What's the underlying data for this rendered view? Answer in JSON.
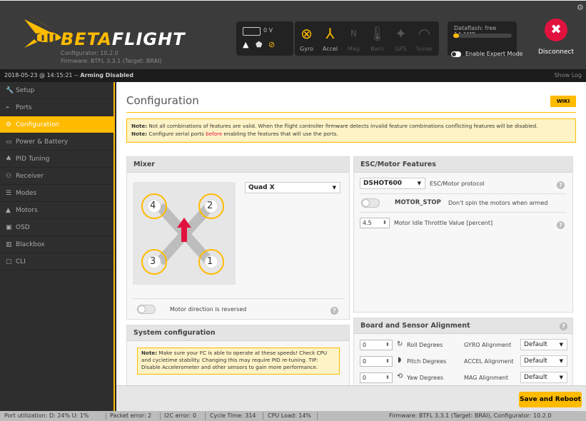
{
  "header": {
    "brand_left": "BETA",
    "brand_right": "FLIGHT",
    "configurator_version": "Configurator: 10.2.0",
    "firmware_version": "Firmware: BTFL 3.3.1 (Target: BRAI)",
    "battery_voltage": "0 V",
    "sensors": [
      {
        "label": "Gyro",
        "icon": "gyro-icon",
        "active": true
      },
      {
        "label": "Accel",
        "icon": "accel-icon",
        "active": true
      },
      {
        "label": "Mag",
        "icon": "mag-icon",
        "active": false
      },
      {
        "label": "Baro",
        "icon": "baro-icon",
        "active": false
      },
      {
        "label": "GPS",
        "icon": "gps-icon",
        "active": false
      },
      {
        "label": "Sonar",
        "icon": "sonar-icon",
        "active": false
      }
    ],
    "dataflash_label": "Dataflash: free 14.1MB",
    "dataflash_used_fraction": 0.1,
    "expert_mode_label": "Enable Expert Mode",
    "disconnect_label": "Disconnect",
    "accent_color": "#ffbb00",
    "disconnect_color": "#e2123f"
  },
  "status": {
    "datetime": "2018-05-23 @ 14:15:21",
    "separator": " -- ",
    "arming": "Arming Disabled",
    "show_log": "Show Log"
  },
  "sidebar": {
    "items": [
      {
        "label": "Setup",
        "icon": "wrench-icon",
        "active": false
      },
      {
        "label": "Ports",
        "icon": "plug-icon",
        "active": false
      },
      {
        "label": "Configuration",
        "icon": "gear-icon",
        "active": true
      },
      {
        "label": "Power & Battery",
        "icon": "battery-icon",
        "active": false
      },
      {
        "label": "PID Tuning",
        "icon": "pid-icon",
        "active": false
      },
      {
        "label": "Receiver",
        "icon": "receiver-icon",
        "active": false
      },
      {
        "label": "Modes",
        "icon": "modes-icon",
        "active": false
      },
      {
        "label": "Motors",
        "icon": "motor-icon",
        "active": false
      },
      {
        "label": "OSD",
        "icon": "osd-icon",
        "active": false
      },
      {
        "label": "Blackbox",
        "icon": "blackbox-icon",
        "active": false
      },
      {
        "label": "CLI",
        "icon": "cli-icon",
        "active": false
      }
    ]
  },
  "main": {
    "title": "Configuration",
    "wiki": "WIKI",
    "note1_prefix": "Note:",
    "note1_text": " Not all combinations of features are valid. When the flight controller firmware detects invalid feature combinations conflicting features will be disabled.",
    "note2_prefix": "Note:",
    "note2_text_a": " Configure serial ports ",
    "note2_red": "before",
    "note2_text_b": " enabling the features that will use the ports.",
    "mixer": {
      "title": "Mixer",
      "selected": "Quad X",
      "motor_labels": [
        "4",
        "2",
        "3",
        "1"
      ],
      "reversed_label": "Motor direction is reversed",
      "help": "?"
    },
    "system": {
      "title": "System configuration",
      "note_prefix": "Note:",
      "note_text": " Make sure your FC is able to operate at these speeds! Check CPU and cycletime stability. Changing this may require PID re-tuning. TIP: Disable Accelerometer and other sensors to gain more performance."
    },
    "esc": {
      "title": "ESC/Motor Features",
      "protocol_value": "DSHOT600",
      "protocol_label": "ESC/Motor protocol",
      "motor_stop_label": "MOTOR_STOP",
      "motor_stop_desc": "Don't spin the motors when armed",
      "idle_value": "4.5",
      "idle_label": "Motor Idle Throttle Value [percent]",
      "help": "?"
    },
    "board": {
      "title": "Board and Sensor Alignment",
      "help": "?",
      "rows": [
        {
          "value": "0",
          "label": "Roll Degrees",
          "align_label": "GYRO Alignment",
          "align_value": "Default",
          "icon": "roll-icon"
        },
        {
          "value": "0",
          "label": "Pitch Degrees",
          "align_label": "ACCEL Alignment",
          "align_value": "Default",
          "icon": "pitch-icon"
        },
        {
          "value": "0",
          "label": "Yaw Degrees",
          "align_label": "MAG Alignment",
          "align_value": "Default",
          "icon": "yaw-icon"
        }
      ]
    },
    "save_button": "Save and Reboot"
  },
  "footer": {
    "port_util": "Port utilization: D: 24% U: 1%",
    "packet_error": "Packet error: 2",
    "i2c_error": "I2C error: 0",
    "cycle_time": "Cycle Time: 314",
    "cpu_load": "CPU Load: 14%",
    "firmware": "Firmware: BTFL 3.3.1 (Target: BRAI), Configurator: 10.2.0"
  }
}
